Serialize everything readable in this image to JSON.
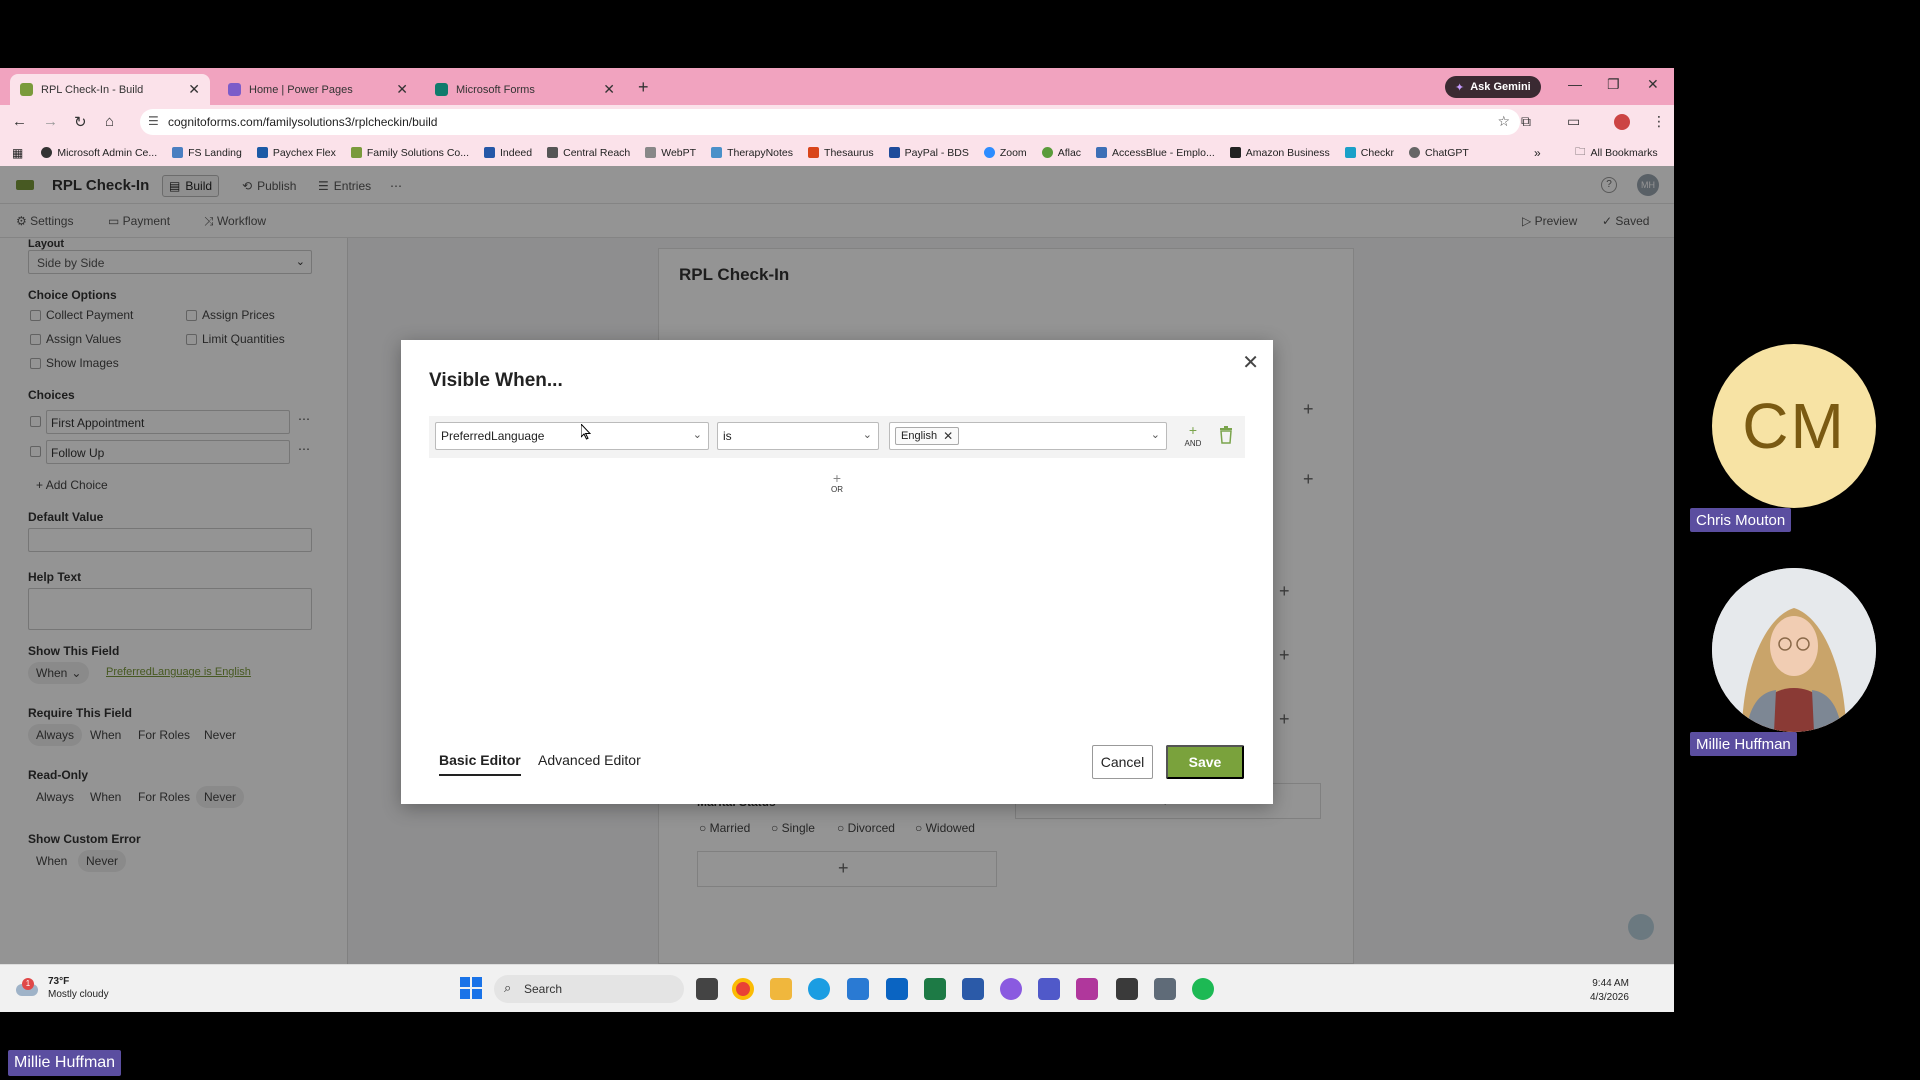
{
  "browser": {
    "tabs": [
      {
        "label": "RPL Check-In - Build",
        "color": "#7a9a3b"
      },
      {
        "label": "Home | Power Pages",
        "color": "#7b5cc9"
      },
      {
        "label": "Microsoft Forms",
        "color": "#0f7b6c"
      }
    ],
    "gemini_label": "Ask Gemini",
    "url": "cognitoforms.com/familysolutions3/rplcheckin/build",
    "bookmarks": [
      "Microsoft Admin Ce...",
      "FS Landing",
      "Paychex Flex",
      "Family Solutions Co...",
      "Indeed",
      "Central Reach",
      "WebPT",
      "TherapyNotes",
      "Thesaurus",
      "PayPal - BDS",
      "Zoom",
      "Aflac",
      "AccessBlue - Emplo...",
      "Amazon Business",
      "Checkr",
      "ChatGPT"
    ],
    "all_bookmarks": "All Bookmarks"
  },
  "app": {
    "title": "RPL Check-In",
    "tabs": [
      "Build",
      "Publish",
      "Entries"
    ],
    "subtabs": [
      "Settings",
      "Payment",
      "Workflow"
    ],
    "preview": "Preview",
    "saved": "Saved",
    "avatar_initials": "MH",
    "sidebar": {
      "layout_label": "Layout",
      "layout_value": "Side by Side",
      "choice_options": "Choice Options",
      "collect_payment": "Collect Payment",
      "assign_prices": "Assign Prices",
      "assign_values": "Assign Values",
      "limit_quantities": "Limit Quantities",
      "show_images": "Show Images",
      "choices_label": "Choices",
      "choice_1": "First Appointment",
      "choice_2": "Follow Up",
      "add_choice": "Add Choice",
      "default_value": "Default Value",
      "help_text": "Help Text",
      "show_field": "Show This Field",
      "show_when": "When",
      "show_condition": "PreferredLanguage is English",
      "require_field": "Require This Field",
      "read_only": "Read-Only",
      "custom_error": "Show Custom Error",
      "opt_always": "Always",
      "opt_when": "When",
      "opt_roles": "For Roles",
      "opt_never": "Never"
    },
    "canvas": {
      "form_title": "RPL Check-In",
      "marital_label": "Marital Status",
      "marital_options": [
        "Married",
        "Single",
        "Divorced",
        "Widowed"
      ]
    }
  },
  "modal": {
    "title": "Visible When...",
    "field_value": "PreferredLanguage",
    "operator_value": "is",
    "chip_value": "English",
    "and_label": "AND",
    "or_label": "OR",
    "basic_editor": "Basic Editor",
    "advanced_editor": "Advanced Editor",
    "cancel": "Cancel",
    "save": "Save"
  },
  "taskbar": {
    "temp": "73°F",
    "weather": "Mostly cloudy",
    "search": "Search",
    "time": "9:44 AM",
    "date": "4/3/2026"
  },
  "participants": {
    "cm_initials": "CM",
    "cm_name": "Chris Mouton",
    "mh_name": "Millie Huffman",
    "speaker": "Millie Huffman"
  }
}
